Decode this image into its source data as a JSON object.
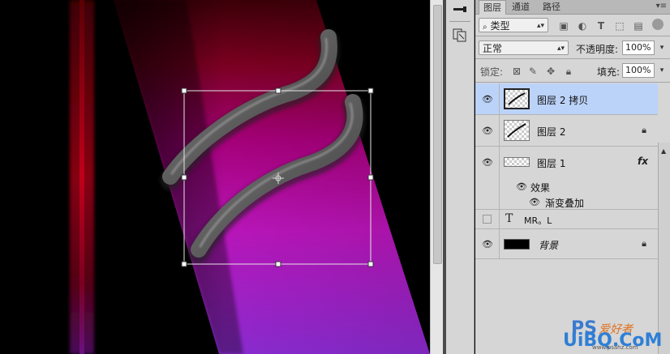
{
  "colors": {
    "panel_bg": "#d6d6d6",
    "selected_row": "#bcd3f9",
    "canvas_bg": "#000000"
  },
  "panel": {
    "tabs": [
      {
        "label": "图层",
        "active": true
      },
      {
        "label": "通道",
        "active": false
      },
      {
        "label": "路径",
        "active": false
      }
    ],
    "filter": {
      "label": "类型",
      "icons": [
        "image-filter-icon",
        "adjustment-filter-icon",
        "type-filter-icon",
        "shape-filter-icon",
        "smart-object-filter-icon"
      ]
    },
    "blend_mode": "正常",
    "opacity_label": "不透明度:",
    "opacity_value": "100%",
    "lock_label": "锁定:",
    "fill_label": "填充:",
    "fill_value": "100%"
  },
  "layers": [
    {
      "name": "图层 2 拷贝",
      "visible": true,
      "selected": true,
      "locked": false
    },
    {
      "name": "图层 2",
      "visible": true,
      "selected": false,
      "locked": true
    },
    {
      "name": "图层 1",
      "visible": true,
      "selected": false,
      "locked": false,
      "fx": "fx"
    },
    {
      "name": "效果",
      "type": "effects-header"
    },
    {
      "name": "渐变叠加",
      "type": "effect"
    },
    {
      "name": "MR。L",
      "visible": false,
      "type": "text",
      "type_glyph": "T"
    },
    {
      "name": "背景",
      "visible": true,
      "locked": true,
      "type": "background"
    }
  ],
  "watermark": {
    "ps_text": "PS",
    "site_text": "爱好者",
    "logo_text": "UiBQ.CoM",
    "url_text": "www.psahz.com"
  }
}
